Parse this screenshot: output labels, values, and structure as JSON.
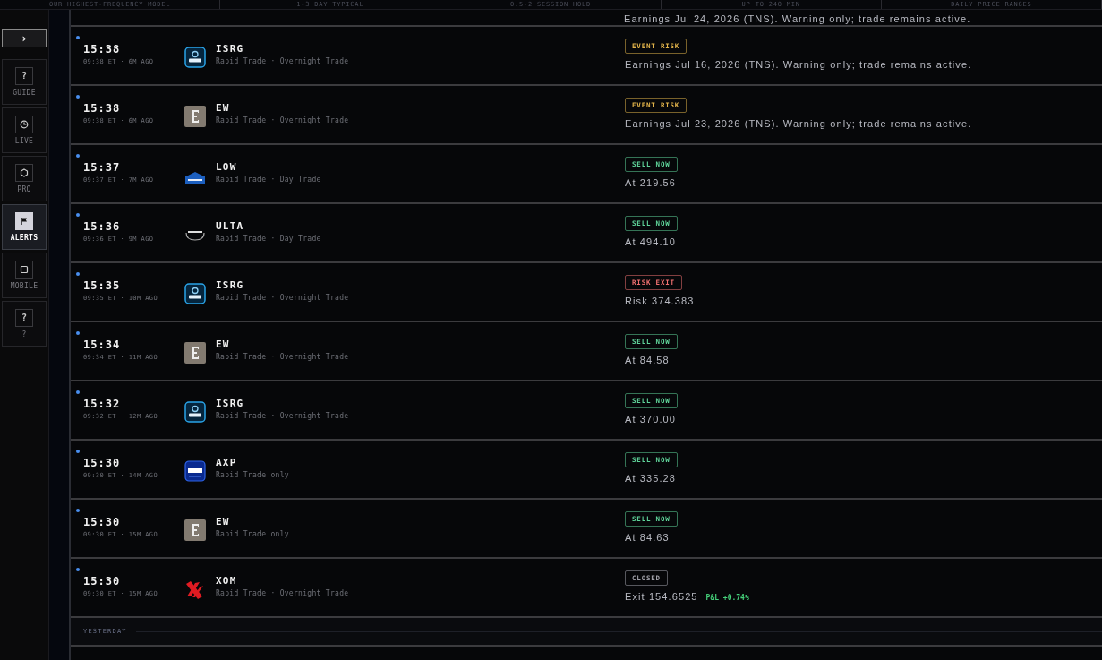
{
  "header_stats": [
    "OUR HIGHEST-FREQUENCY MODEL",
    "1-3 DAY TYPICAL",
    "0.5-2 SESSION HOLD",
    "UP TO 240 MIN",
    "DAILY PRICE RANGES"
  ],
  "sidebar": {
    "toggle": "›",
    "items": [
      {
        "kind": "glyph",
        "glyph": "?",
        "label": "GUIDE",
        "selected": false
      },
      {
        "kind": "clock",
        "label": "LIVE",
        "selected": false
      },
      {
        "kind": "hexagon",
        "label": "PRO",
        "selected": false
      },
      {
        "kind": "flag",
        "label": "ALERTS",
        "selected": true
      },
      {
        "kind": "square",
        "label": "MOBILE",
        "selected": false
      },
      {
        "kind": "glyph",
        "glyph": "?",
        "label": "?",
        "selected": false
      }
    ]
  },
  "previous_message": "Earnings Jul 24, 2026 (TNS). Warning only; trade remains active.",
  "alerts": [
    {
      "unread": true,
      "time": "15:38",
      "meta": "09:38 ET · 6M AGO",
      "kind": "ring",
      "ticker": "ISRG",
      "strategy": "Rapid Trade · Overnight Trade",
      "badge": {
        "label": "EVENT RISK",
        "color": "#e0b24a"
      },
      "message": "Earnings Jul 16, 2026 (TNS). Warning only; trade remains active."
    },
    {
      "unread": true,
      "time": "15:38",
      "meta": "09:38 ET · 6M AGO",
      "kind": "tile",
      "ticker": "EW",
      "strategy": "Rapid Trade · Overnight Trade",
      "badge": {
        "label": "EVENT RISK",
        "color": "#e0b24a"
      },
      "message": "Earnings Jul 23, 2026 (TNS). Warning only; trade remains active."
    },
    {
      "unread": true,
      "time": "15:37",
      "meta": "09:37 ET · 7M AGO",
      "kind": "roof",
      "ticker": "LOW",
      "strategy": "Rapid Trade · Day Trade",
      "badge": {
        "label": "SELL NOW",
        "color": "#5fd49a"
      },
      "message": "At 219.56"
    },
    {
      "unread": true,
      "time": "15:36",
      "meta": "09:36 ET · 9M AGO",
      "kind": "arc",
      "ticker": "ULTA",
      "strategy": "Rapid Trade · Day Trade",
      "badge": {
        "label": "SELL NOW",
        "color": "#5fd49a"
      },
      "message": "At 494.10"
    },
    {
      "unread": true,
      "time": "15:35",
      "meta": "09:35 ET · 10M AGO",
      "kind": "ring",
      "ticker": "ISRG",
      "strategy": "Rapid Trade · Overnight Trade",
      "badge": {
        "label": "RISK EXIT",
        "color": "#f07070"
      },
      "message": "Risk 374.383"
    },
    {
      "unread": true,
      "time": "15:34",
      "meta": "09:34 ET · 11M AGO",
      "kind": "tile",
      "ticker": "EW",
      "strategy": "Rapid Trade · Overnight Trade",
      "badge": {
        "label": "SELL NOW",
        "color": "#5fd49a"
      },
      "message": "At 84.58"
    },
    {
      "unread": true,
      "time": "15:32",
      "meta": "09:32 ET · 12M AGO",
      "kind": "ring",
      "ticker": "ISRG",
      "strategy": "Rapid Trade · Overnight Trade",
      "badge": {
        "label": "SELL NOW",
        "color": "#5fd49a"
      },
      "message": "At 370.00"
    },
    {
      "unread": true,
      "time": "15:30",
      "meta": "09:30 ET · 14M AGO",
      "kind": "card",
      "ticker": "AXP",
      "strategy": "Rapid Trade only",
      "badge": {
        "label": "SELL NOW",
        "color": "#5fd49a"
      },
      "message": "At 335.28"
    },
    {
      "unread": true,
      "time": "15:30",
      "meta": "09:30 ET · 15M AGO",
      "kind": "tile",
      "ticker": "EW",
      "strategy": "Rapid Trade only",
      "badge": {
        "label": "SELL NOW",
        "color": "#5fd49a"
      },
      "message": "At 84.63"
    },
    {
      "unread": true,
      "time": "15:30",
      "meta": "09:30 ET · 15M AGO",
      "kind": "cross",
      "ticker": "XOM",
      "strategy": "Rapid Trade · Overnight Trade",
      "badge": {
        "label": "CLOSED",
        "color": "#a0a0a8"
      },
      "message": "Exit 154.6525",
      "pnl": "P&L +0.74%"
    }
  ],
  "section_divider": "YESTERDAY"
}
